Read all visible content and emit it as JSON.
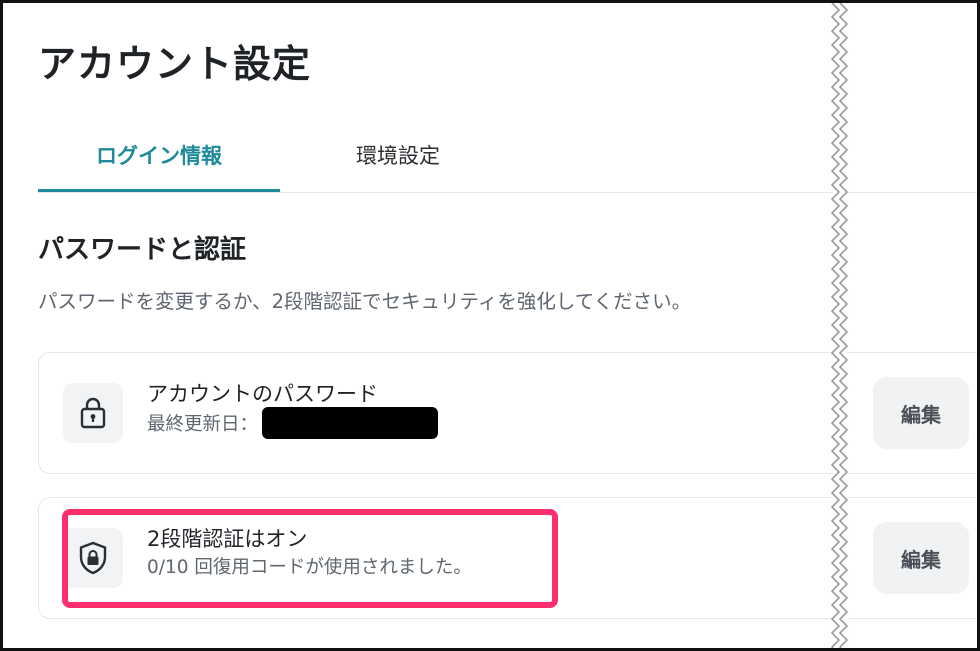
{
  "page": {
    "title": "アカウント設定"
  },
  "tabs": [
    {
      "label": "ログイン情報",
      "active": true
    },
    {
      "label": "環境設定",
      "active": false
    }
  ],
  "section": {
    "title": "パスワードと認証",
    "description": "パスワードを変更するか、2段階認証でセキュリティを強化してください。"
  },
  "password_card": {
    "icon": "lock-icon",
    "title": "アカウントのパスワード",
    "updated_label": "最終更新日：",
    "edit_label": "編集"
  },
  "twofa_card": {
    "icon": "shield-lock-icon",
    "title": "2段階認証はオン",
    "subtitle": "0/10 回復用コードが使用されました。",
    "edit_label": "編集"
  },
  "colors": {
    "accent": "#1f8a9a",
    "highlight": "#ff2f6e",
    "text": "#1f2328",
    "muted": "#5f6670"
  }
}
